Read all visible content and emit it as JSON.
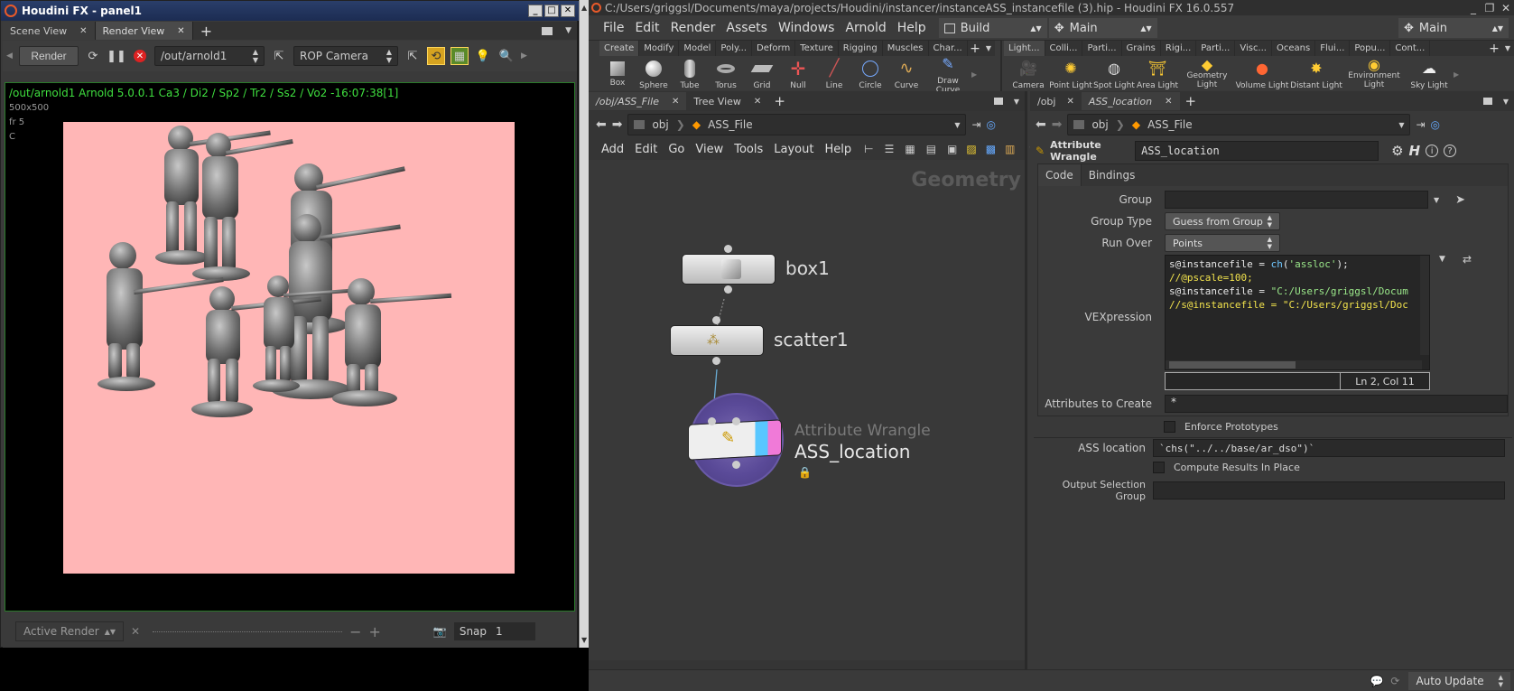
{
  "left": {
    "title": "Houdini FX - panel1",
    "tabs": [
      "Scene View",
      "Render View"
    ],
    "render_button": "Render",
    "output_path": "/out/arnold1",
    "camera": "ROP Camera",
    "render_info": "/out/arnold1   Arnold 5.0.0.1   Ca3 / Di2 / Sp2 / Tr2 / Ss2 / Vo2 -16:07:38[1]",
    "res": "500x500",
    "frame": "fr 5",
    "channel": "C",
    "footer_dropdown": "Active Render",
    "snap_label": "Snap",
    "snap_value": "1",
    "render_bg": "#ffb6b6",
    "status_text_color": "#3fdf3f"
  },
  "right": {
    "title": "C:/Users/griggsl/Documents/maya/projects/Houdini/instancer/instanceASS_instancefile (3).hip - Houdini FX 16.0.557",
    "menus": [
      "File",
      "Edit",
      "Render",
      "Assets",
      "Windows",
      "Arnold",
      "Help"
    ],
    "desktop_label": "Build",
    "main_label": "Main",
    "main_label2": "Main",
    "shelf_tabs_left": [
      "Create",
      "Modify",
      "Model",
      "Poly...",
      "Deform",
      "Texture",
      "Rigging",
      "Muscles",
      "Char..."
    ],
    "shelf_tools_left": [
      "Box",
      "Sphere",
      "Tube",
      "Torus",
      "Grid",
      "Null",
      "Line",
      "Circle",
      "Curve",
      "Draw Curve"
    ],
    "shelf_tabs_right": [
      "Light...",
      "Colli...",
      "Parti...",
      "Grains",
      "Rigi...",
      "Parti...",
      "Visc...",
      "Oceans",
      "Flui...",
      "Popu...",
      "Cont..."
    ],
    "shelf_tools_right": [
      "Camera",
      "Point Light",
      "Spot Light",
      "Area Light",
      "Geometry Light",
      "Volume Light",
      "Distant Light",
      "Environment Light",
      "Sky Light"
    ],
    "network": {
      "tabs": [
        "/obj/ASS_File",
        "Tree View"
      ],
      "path": [
        "obj",
        "ASS_File"
      ],
      "menus": [
        "Add",
        "Edit",
        "Go",
        "View",
        "Tools",
        "Layout",
        "Help"
      ],
      "context_label": "Geometry",
      "nodes": [
        {
          "name": "box1"
        },
        {
          "name": "scatter1"
        },
        {
          "name": "ASS_location",
          "type": "Attribute Wrangle"
        }
      ]
    },
    "params": {
      "tabs": [
        "/obj",
        "ASS_location"
      ],
      "path": [
        "obj",
        "ASS_File"
      ],
      "node_type": "Attribute Wrangle",
      "node_name": "ASS_location",
      "sub_tabs": [
        "Code",
        "Bindings"
      ],
      "group_label": "Group",
      "group_value": "",
      "group_type_label": "Group Type",
      "group_type_value": "Guess from Group",
      "run_over_label": "Run Over",
      "run_over_value": "Points",
      "vex_label": "VEXpression",
      "code_lines": [
        {
          "seg": [
            {
              "t": "s@instancefile = ",
              "c": "#e8e8e8"
            },
            {
              "t": "ch",
              "c": "#6fc7ff"
            },
            {
              "t": "(",
              "c": "#e8e8e8"
            },
            {
              "t": "'assloc'",
              "c": "#9be88a"
            },
            {
              "t": ");",
              "c": "#e8e8e8"
            }
          ]
        },
        {
          "seg": [
            {
              "t": "//@pscale=100;",
              "c": "#f2e34d"
            }
          ]
        },
        {
          "seg": [
            {
              "t": "s@instancefile = ",
              "c": "#e8e8e8"
            },
            {
              "t": "\"C:/Users/griggsl/Docum",
              "c": "#9be88a"
            }
          ]
        },
        {
          "seg": [
            {
              "t": "//s@instancefile = \"C:/Users/griggsl/Doc",
              "c": "#f2e34d"
            }
          ]
        }
      ],
      "cursor_pos": "Ln 2, Col 11",
      "attr_create_label": "Attributes to Create",
      "attr_create_value": "*",
      "enforce_label": "Enforce Prototypes",
      "ass_location_label": "ASS location",
      "ass_location_value": "`chs(\"../../base/ar_dso\")`",
      "compute_label": "Compute Results In Place",
      "output_sel_label": "Output Selection Group",
      "output_sel_value": ""
    },
    "status": {
      "auto_update": "Auto Update"
    }
  }
}
